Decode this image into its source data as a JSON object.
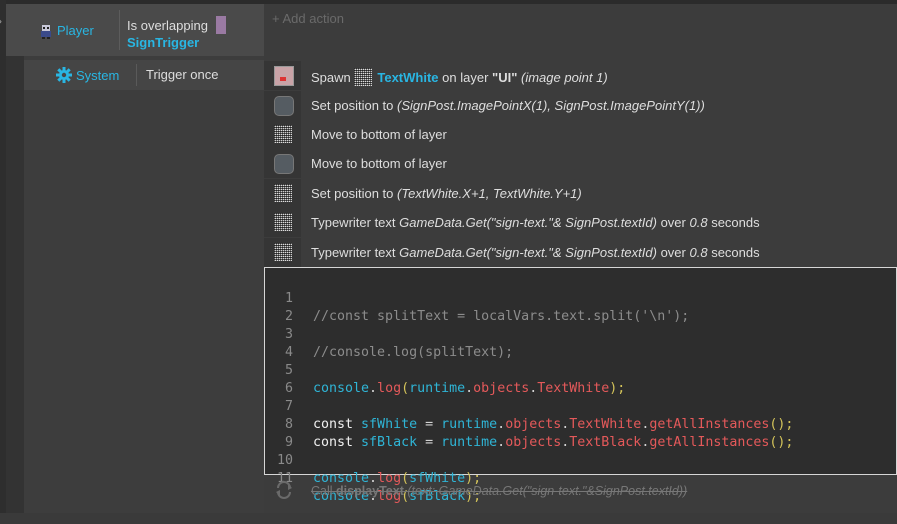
{
  "left_tab": {
    "glyph": "›"
  },
  "event": {
    "condition1": {
      "object": "Player",
      "text": "Is overlapping",
      "param": "SignTrigger"
    },
    "condition2": {
      "object": "System",
      "text": "Trigger once"
    }
  },
  "add_action_label": "+ Add action",
  "actions": [
    {
      "pre": "Spawn",
      "object": "TextWhite",
      "mid": "on layer",
      "layer": "\"UI\"",
      "tail": "(image point 1)"
    },
    {
      "pre": "Set position to",
      "args": "(SignPost.ImagePointX(1), SignPost.ImagePointY(1))"
    },
    {
      "text": "Move to bottom of layer"
    },
    {
      "text": "Move to bottom of layer"
    },
    {
      "pre": "Set position to",
      "args": "(TextWhite.X+1, TextWhite.Y+1)"
    },
    {
      "pre": "Typewriter text",
      "expr": "GameData.Get(\"sign-text.\"& SignPost.textId)",
      "mid": "over",
      "num": "0.8",
      "unit": "seconds"
    },
    {
      "pre": "Typewriter text",
      "expr": "GameData.Get(\"sign-text.\"& SignPost.textId)",
      "mid": "over",
      "num": "0.8",
      "unit": "seconds"
    }
  ],
  "code_lines": {
    "l1": {
      "n": "1",
      "text": "//const splitText = localVars.text.split('\\n');"
    },
    "l2": {
      "n": "2"
    },
    "l3": {
      "n": "3",
      "text": "//console.log(splitText);"
    },
    "l4": {
      "n": "4"
    },
    "l5": {
      "n": "5",
      "a": "console",
      "b": ".",
      "c": "log",
      "d": "(",
      "e": "runtime",
      "f": ".",
      "g": "objects",
      "h": ".",
      "i": "TextWhite",
      "j": ");"
    },
    "l6": {
      "n": "6"
    },
    "l7": {
      "n": "7",
      "kw": "const ",
      "var": "sfWhite",
      "eq": " = ",
      "e": "runtime",
      "f": ".",
      "g": "objects",
      "h": ".",
      "i": "TextWhite",
      "k": ".",
      "m": "getAllInstances",
      "j": "();"
    },
    "l8": {
      "n": "8",
      "kw": "const ",
      "var": "sfBlack",
      "eq": " = ",
      "e": "runtime",
      "f": ".",
      "g": "objects",
      "h": ".",
      "i": "TextBlack",
      "k": ".",
      "m": "getAllInstances",
      "j": "();"
    },
    "l9": {
      "n": "9"
    },
    "l10": {
      "n": "10",
      "a": "console",
      "b": ".",
      "c": "log",
      "d": "(",
      "v": "sfWhite",
      "j": ");"
    },
    "l11": {
      "n": "11",
      "a": "console",
      "b": ".",
      "c": "log",
      "d": "(",
      "v": "sfBlack",
      "j": ");"
    }
  },
  "disabled_action": {
    "pre": "Call",
    "fn": "displayText",
    "args": "(text: GameData.Get(\"sign-text.\"&SignPost.textId))"
  }
}
